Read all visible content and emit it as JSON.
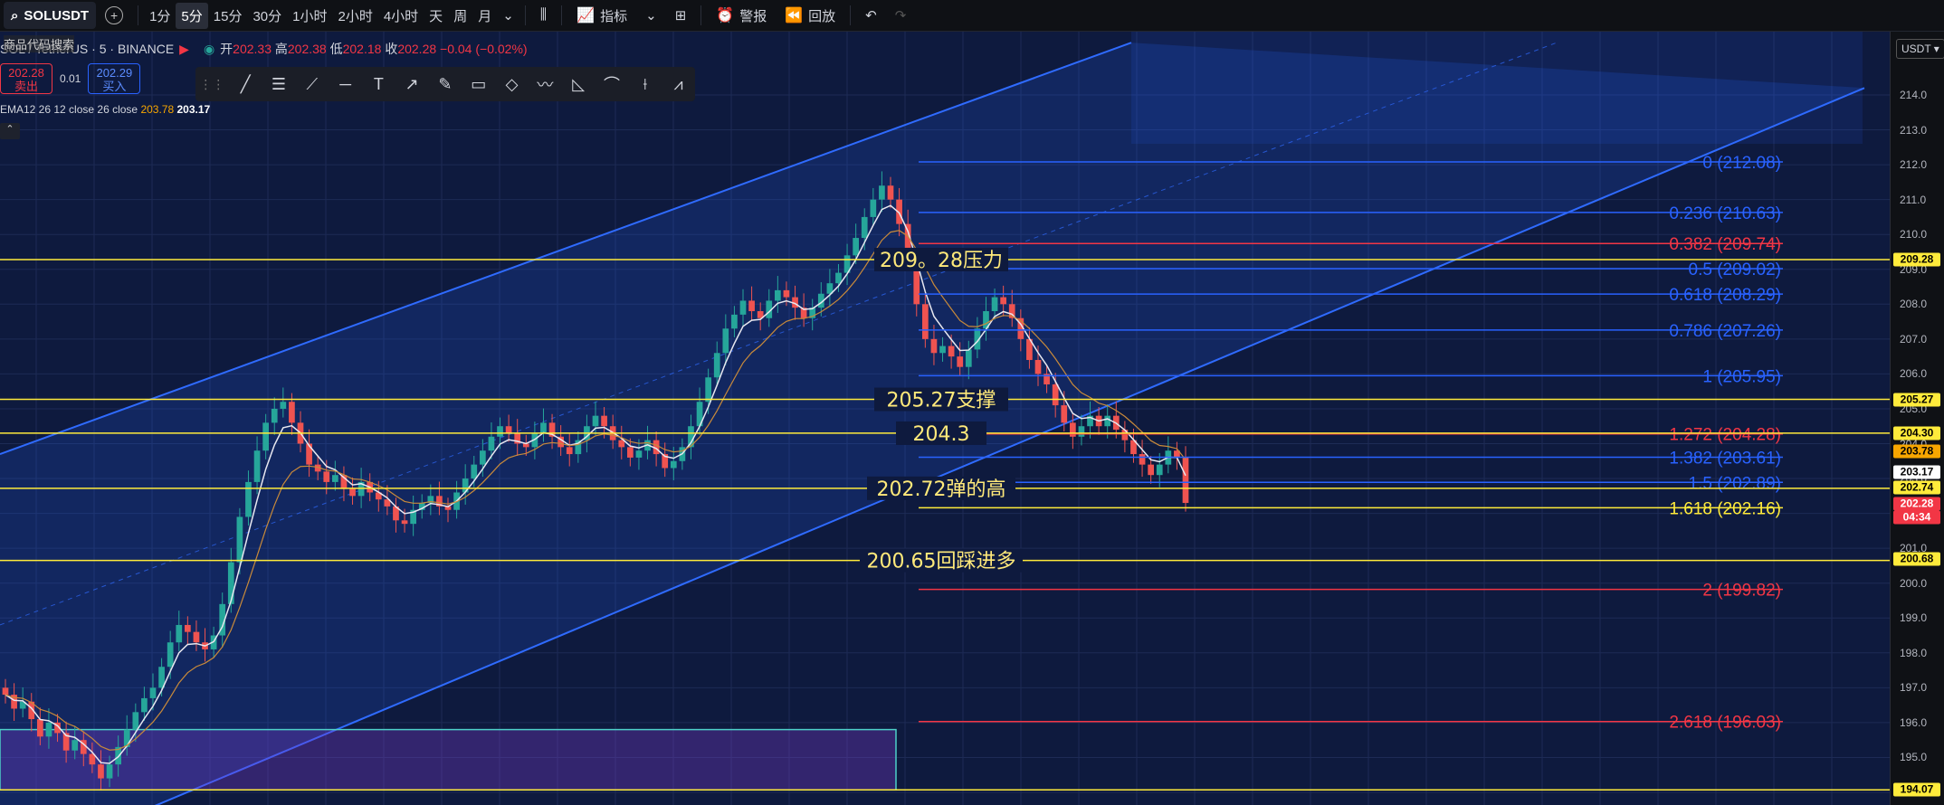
{
  "topbar": {
    "symbol": "SOLUSDT",
    "timeframes": [
      "1分",
      "5分",
      "15分",
      "30分",
      "1小时",
      "2小时",
      "4小时",
      "天",
      "周",
      "月"
    ],
    "active_timeframe": "5分",
    "indicators_label": "指标",
    "alert_label": "警报",
    "replay_label": "回放"
  },
  "legend": {
    "search_hint": "商品代码搜索",
    "pair": "SOL / TetherUS · 5 · BINANCE",
    "open_label": "开",
    "open": "202.33",
    "high_label": "高",
    "high": "202.38",
    "low_label": "低",
    "low": "202.18",
    "close_label": "收",
    "close": "202.28",
    "change": "−0.04 (−0.02%)"
  },
  "order": {
    "sell_price": "202.28",
    "sell_label": "卖出",
    "spread": "0.01",
    "buy_price": "202.29",
    "buy_label": "买入"
  },
  "ema": {
    "label": "EMA12 26 12 close 26 close",
    "value1": "203.78",
    "value2": "203.17"
  },
  "axis": {
    "currency": "USDT",
    "ticks": [
      214,
      213,
      212,
      211,
      210,
      209,
      208,
      207,
      206,
      205,
      204,
      203,
      202,
      201,
      200,
      199,
      198,
      197,
      196,
      195,
      194
    ]
  },
  "price_tags": [
    {
      "text": "209.28",
      "price": 209.28,
      "bg": "#ffeb3b",
      "fg": "#000"
    },
    {
      "text": "205.27",
      "price": 205.27,
      "bg": "#ffeb3b",
      "fg": "#000"
    },
    {
      "text": "204.30",
      "price": 204.3,
      "bg": "#ffeb3b",
      "fg": "#000"
    },
    {
      "text": "203.78",
      "price": 203.78,
      "bg": "#f7a600",
      "fg": "#000"
    },
    {
      "text": "203.17",
      "price": 203.17,
      "bg": "#ffffff",
      "fg": "#000"
    },
    {
      "text": "202.74",
      "price": 202.74,
      "bg": "#ffeb3b",
      "fg": "#000"
    },
    {
      "text": "202.28",
      "price": 202.28,
      "bg": "#f23645",
      "fg": "#fff"
    },
    {
      "text": "04:34",
      "price": 201.88,
      "bg": "#f23645",
      "fg": "#fff"
    },
    {
      "text": "200.68",
      "price": 200.68,
      "bg": "#ffeb3b",
      "fg": "#000"
    },
    {
      "text": "194.07",
      "price": 194.07,
      "bg": "#ffeb3b",
      "fg": "#000"
    }
  ],
  "chart_data": {
    "type": "candlestick",
    "symbol": "SOLUSDT",
    "interval": "5分",
    "ylim": [
      193.6,
      215.5
    ],
    "grid": true,
    "horizontal_levels": [
      {
        "price": 209.28,
        "label": "209。28压力"
      },
      {
        "price": 205.27,
        "label": "205.27支撑"
      },
      {
        "price": 204.3,
        "label": "204.3"
      },
      {
        "price": 202.72,
        "label": "202.72弹的高"
      },
      {
        "price": 200.65,
        "label": "200.65回踩进多"
      },
      {
        "price": 194.07,
        "label": ""
      }
    ],
    "fibonacci": [
      {
        "ratio": "0",
        "price": 212.08,
        "color": "#2962ff"
      },
      {
        "ratio": "0.236",
        "price": 210.63,
        "color": "#2962ff"
      },
      {
        "ratio": "0.382",
        "price": 209.74,
        "color": "#f23645"
      },
      {
        "ratio": "0.5",
        "price": 209.02,
        "color": "#2962ff"
      },
      {
        "ratio": "0.618",
        "price": 208.29,
        "color": "#2962ff"
      },
      {
        "ratio": "0.786",
        "price": 207.26,
        "color": "#2962ff"
      },
      {
        "ratio": "1",
        "price": 205.95,
        "color": "#2962ff"
      },
      {
        "ratio": "1.272",
        "price": 204.28,
        "color": "#f23645"
      },
      {
        "ratio": "1.382",
        "price": 203.61,
        "color": "#2962ff"
      },
      {
        "ratio": "1.5",
        "price": 202.89,
        "color": "#2962ff"
      },
      {
        "ratio": "1.618",
        "price": 202.16,
        "color": "#ffeb3b"
      },
      {
        "ratio": "2",
        "price": 199.82,
        "color": "#f23645"
      },
      {
        "ratio": "2.618",
        "price": 196.03,
        "color": "#f23645"
      }
    ],
    "channel": {
      "upper_from": [
        0,
        203.7
      ],
      "upper_to": [
        1250,
        215.5
      ],
      "lower_from": [
        170,
        193.6
      ],
      "lower_to": [
        2060,
        214.2
      ]
    },
    "close_series": [
      196.8,
      196.4,
      196.6,
      196.1,
      195.6,
      196.0,
      195.7,
      195.2,
      195.5,
      195.1,
      194.8,
      194.4,
      194.8,
      195.3,
      195.8,
      196.3,
      196.7,
      197.0,
      197.6,
      198.3,
      198.8,
      198.6,
      198.3,
      198.1,
      198.5,
      199.4,
      200.6,
      201.9,
      202.9,
      203.8,
      204.6,
      205.0,
      205.2,
      204.6,
      204.0,
      203.4,
      203.2,
      202.9,
      203.1,
      202.7,
      202.5,
      202.9,
      202.6,
      202.4,
      202.2,
      201.8,
      201.7,
      202.1,
      202.3,
      202.5,
      202.2,
      202.1,
      202.6,
      203.0,
      203.4,
      203.8,
      204.2,
      204.5,
      204.3,
      204.0,
      203.9,
      204.3,
      204.6,
      204.2,
      203.9,
      203.7,
      204.1,
      204.5,
      204.8,
      204.5,
      204.1,
      203.9,
      203.6,
      203.8,
      204.1,
      203.7,
      203.3,
      203.5,
      203.9,
      204.5,
      205.2,
      205.9,
      206.6,
      207.3,
      207.7,
      208.1,
      207.8,
      207.6,
      208.1,
      208.4,
      208.2,
      207.9,
      207.6,
      207.9,
      208.3,
      208.6,
      208.9,
      209.4,
      209.9,
      210.5,
      211.0,
      211.4,
      211.0,
      210.3,
      209.3,
      208.0,
      207.0,
      206.6,
      206.8,
      206.5,
      206.2,
      206.7,
      207.3,
      207.8,
      208.2,
      208.0,
      207.6,
      207.0,
      206.4,
      206.0,
      205.7,
      205.1,
      204.6,
      204.2,
      204.5,
      204.8,
      204.5,
      204.8,
      204.4,
      204.1,
      203.7,
      203.4,
      203.1,
      203.4,
      203.8,
      203.6,
      202.3
    ]
  }
}
